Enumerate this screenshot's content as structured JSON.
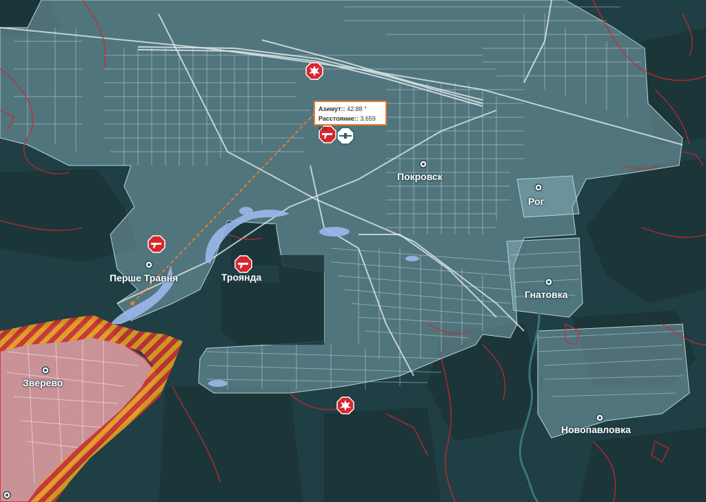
{
  "towns": {
    "pokrovsk": "Покровск",
    "rog": "Рог",
    "pershe_travnya": "Перше Травня",
    "troyanda": "Троянда",
    "gnatovka": "Гнатовка",
    "zverevo": "Зверево",
    "novopavlovka": "Новопавловка"
  },
  "measure": {
    "azimuth_label": "Азимут::",
    "azimuth_value": "42.88 °",
    "distance_label": "Расстояние::",
    "distance_value": "3.659 km"
  },
  "icons": {
    "attack": "gun-icon",
    "explosion": "explosion-icon",
    "drone": "drone-icon",
    "town": "town-marker-icon"
  },
  "colors": {
    "background": "#203f44",
    "field_dark": "#1b3538",
    "urban": "#8fb8c0",
    "occupied": "#e8a1a6",
    "contested_stripe_a": "#e0a020",
    "contested_stripe_b": "#c83030",
    "front_line": "#d2262e",
    "water": "#9bb8ec",
    "event_red": "#d9262e",
    "measure_line": "#ef7a2d"
  }
}
